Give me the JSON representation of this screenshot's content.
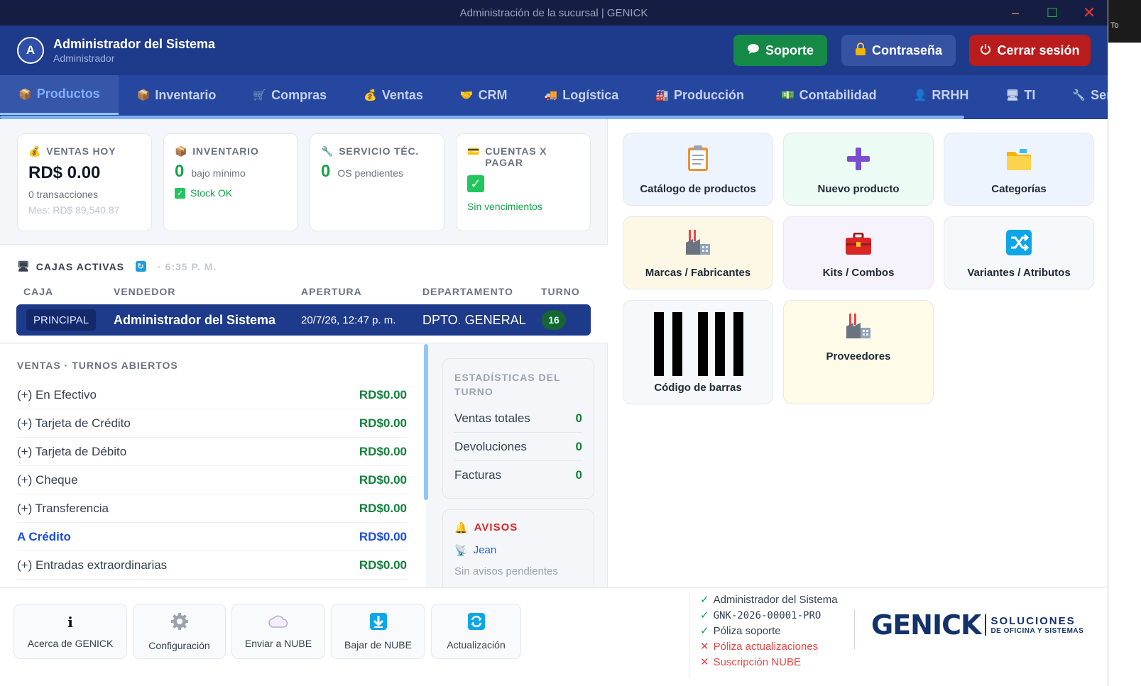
{
  "window": {
    "title": "Administración de la sucursal | GENICK",
    "min": "–",
    "max": "☐",
    "close": "✕",
    "right_edge_text": "To"
  },
  "header": {
    "avatar_initial": "A",
    "user_name": "Administrador del Sistema",
    "user_role": "Administrador",
    "btn_soporte": "Soporte",
    "btn_password": "Contraseña",
    "btn_logout": "Cerrar sesión"
  },
  "tabs": [
    {
      "label": "Productos",
      "icon": "📦"
    },
    {
      "label": "Inventario",
      "icon": "📦"
    },
    {
      "label": "Compras",
      "icon": "🛒"
    },
    {
      "label": "Ventas",
      "icon": "💰"
    },
    {
      "label": "CRM",
      "icon": "🤝"
    },
    {
      "label": "Logística",
      "icon": "🚚"
    },
    {
      "label": "Producción",
      "icon": "🏭"
    },
    {
      "label": "Contabilidad",
      "icon": "💵"
    },
    {
      "label": "RRHH",
      "icon": "👤"
    },
    {
      "label": "TI",
      "icon": "🖥"
    },
    {
      "label": "Servicio T",
      "icon": "🔧"
    }
  ],
  "kpis": {
    "ventas": {
      "title": "VENTAS HOY",
      "amount": "RD$ 0.00",
      "transactions": "0 transacciones",
      "month": "Mes: RD$ 89,540.87"
    },
    "inventario": {
      "title": "INVENTARIO",
      "count": "0",
      "label": "bajo mínimo",
      "ok": "Stock OK"
    },
    "servicio": {
      "title": "SERVICIO TÉC.",
      "count": "0",
      "label": "OS pendientes"
    },
    "cuentas": {
      "title": "CUENTAS X PAGAR",
      "status": "Sin vencimientos"
    }
  },
  "cajas": {
    "title": "CAJAS ACTIVAS",
    "time": "· 6:35 P. M.",
    "headers": [
      "CAJA",
      "VENDEDOR",
      "APERTURA",
      "DEPARTAMENTO",
      "TURNO"
    ],
    "row": {
      "caja": "PRINCIPAL",
      "vendedor": "Administrador del Sistema",
      "apertura": "20/7/26, 12:47 p. m.",
      "departamento": "DPTO. GENERAL",
      "turno": "16"
    }
  },
  "ventas": {
    "title": "VENTAS · TURNOS ABIERTOS",
    "rows": [
      {
        "label": "(+) En Efectivo",
        "amount": "RD$0.00"
      },
      {
        "label": "(+) Tarjeta de Crédito",
        "amount": "RD$0.00"
      },
      {
        "label": "(+) Tarjeta de Débito",
        "amount": "RD$0.00"
      },
      {
        "label": "(+) Cheque",
        "amount": "RD$0.00"
      },
      {
        "label": "(+) Transferencia",
        "amount": "RD$0.00"
      },
      {
        "label": "A Crédito",
        "amount": "RD$0.00"
      },
      {
        "label": "(+) Entradas extraordinarias",
        "amount": "RD$0.00"
      }
    ]
  },
  "stats": {
    "title": "ESTADÍSTICAS DEL TURNO",
    "rows": [
      {
        "label": "Ventas totales",
        "value": "0"
      },
      {
        "label": "Devoluciones",
        "value": "0"
      },
      {
        "label": "Facturas",
        "value": "0"
      }
    ]
  },
  "avisos": {
    "title": "AVISOS",
    "user": "Jean",
    "empty": "Sin avisos pendientes"
  },
  "cards": [
    {
      "label": "Catálogo de productos",
      "icon": "clipboard-icon",
      "bg": "#eef4fd"
    },
    {
      "label": "Nuevo producto",
      "icon": "plus-icon",
      "bg": "#ecfbf3"
    },
    {
      "label": "Categorías",
      "icon": "folder-icon",
      "bg": "#eef4fd"
    },
    {
      "label": "Marcas / Fabricantes",
      "icon": "factory-icon",
      "bg": "#fdf8e6"
    },
    {
      "label": "Kits / Combos",
      "icon": "toolbox-icon",
      "bg": "#f7f3fd"
    },
    {
      "label": "Variantes / Atributos",
      "icon": "shuffle-icon",
      "bg": "#f6f8fb"
    },
    {
      "label": "Código de barras",
      "icon": "barcode-icon",
      "bg": "#f6f8fb"
    },
    {
      "label": "Proveedores",
      "icon": "factory-icon",
      "bg": "#fefbe8"
    }
  ],
  "footer": {
    "buttons": [
      {
        "label": "Acerca de GENICK",
        "icon": "info-icon"
      },
      {
        "label": "Configuración",
        "icon": "gear-icon"
      },
      {
        "label": "Enviar a NUBE",
        "icon": "cloud-icon"
      },
      {
        "label": "Bajar de NUBE",
        "icon": "download-icon"
      },
      {
        "label": "Actualización",
        "icon": "refresh-icon"
      }
    ],
    "license": [
      {
        "text": "Administrador del Sistema",
        "ok": true
      },
      {
        "text": "GNK-2026-00001-PRO",
        "ok": true
      },
      {
        "text": "Póliza soporte",
        "ok": true
      },
      {
        "text": "Póliza actualizaciones",
        "ok": false
      },
      {
        "text": "Suscripción NUBE",
        "ok": false
      }
    ],
    "logo_main": "GENICK",
    "logo_sub1": "SOLUCIONES",
    "logo_sub2": "DE OFICINA Y SISTEMAS"
  }
}
